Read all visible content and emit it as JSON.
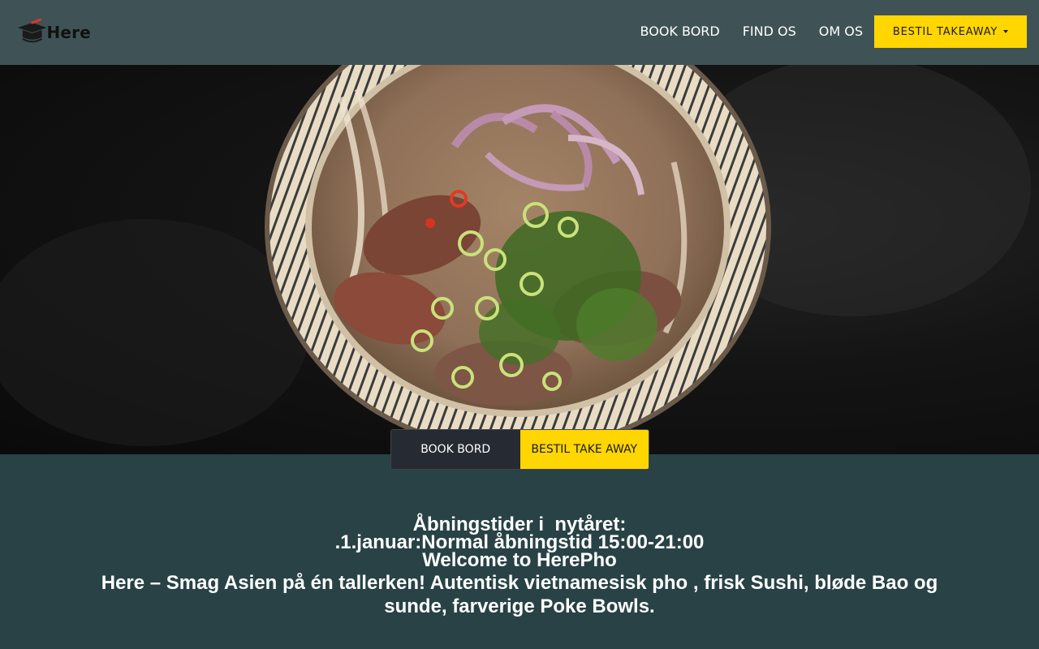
{
  "header": {
    "logo_text": "Here",
    "nav": [
      {
        "label": "BOOK BORD"
      },
      {
        "label": "FIND OS"
      },
      {
        "label": "OM OS"
      }
    ],
    "takeaway_button": "BESTIL TAKEAWAY"
  },
  "hero": {
    "buttons": {
      "book": "BOOK BORD",
      "takeaway": "BESTIL TAKE AWAY"
    }
  },
  "info": {
    "line1": "Åbningstider i  nytåret:",
    "line2": ".1.januar:Normal åbningstid 15:00-21:00",
    "line3": "Welcome to HerePho",
    "line4": "Here – Smag Asien på én tallerken! Autentisk vietnamesisk pho , frisk Sushi, bløde Bao og sunde, farverige Poke Bowls."
  },
  "colors": {
    "header_bg": "#3f5356",
    "page_bg": "#284246",
    "accent_yellow": "#ffd600",
    "dark_button": "#262a33"
  },
  "icons": [
    "logo-hat-icon",
    "caret-down-icon",
    "pho-bowl-image"
  ]
}
